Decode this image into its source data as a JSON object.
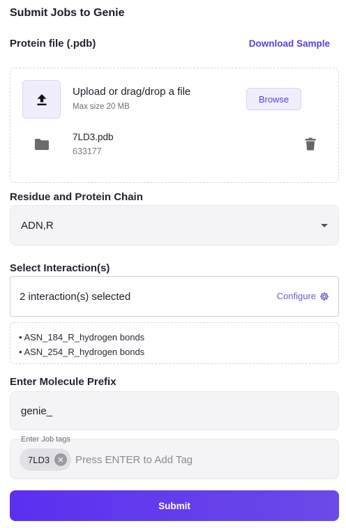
{
  "page_title": "Submit Jobs to Genie",
  "protein_file": {
    "label": "Protein file (.pdb)",
    "download_sample": "Download Sample",
    "upload_title": "Upload or drag/drop a file",
    "upload_hint": "Max size 20 MB",
    "browse_label": "Browse",
    "uploaded_file": {
      "name": "7LD3.pdb",
      "size": "633177"
    }
  },
  "residue_chain": {
    "label": "Residue and Protein Chain",
    "selected_value": "ADN,R"
  },
  "interactions": {
    "label": "Select Interaction(s)",
    "summary": "2 interaction(s) selected",
    "configure_label": "Configure",
    "items": [
      "• ASN_184_R_hydrogen bonds",
      "• ASN_254_R_hydrogen bonds"
    ]
  },
  "molecule_prefix": {
    "label": "Enter Molecule Prefix",
    "value": "genie_"
  },
  "job_tags": {
    "label": "Enter Job tags",
    "tags": [
      "7LD3"
    ],
    "placeholder": "Press ENTER to Add Tag"
  },
  "submit_label": "Submit",
  "colors": {
    "accent": "#5b3fe0",
    "submit_gradient_start": "#5b2ff0",
    "submit_gradient_end": "#6b4ae8",
    "field_bg": "#f4f4f6"
  },
  "icons": {
    "upload": "upload-icon",
    "folder": "folder-icon",
    "trash": "trash-icon",
    "caret": "caret-down-icon",
    "gear": "gear-icon",
    "close": "close-circle-icon"
  }
}
